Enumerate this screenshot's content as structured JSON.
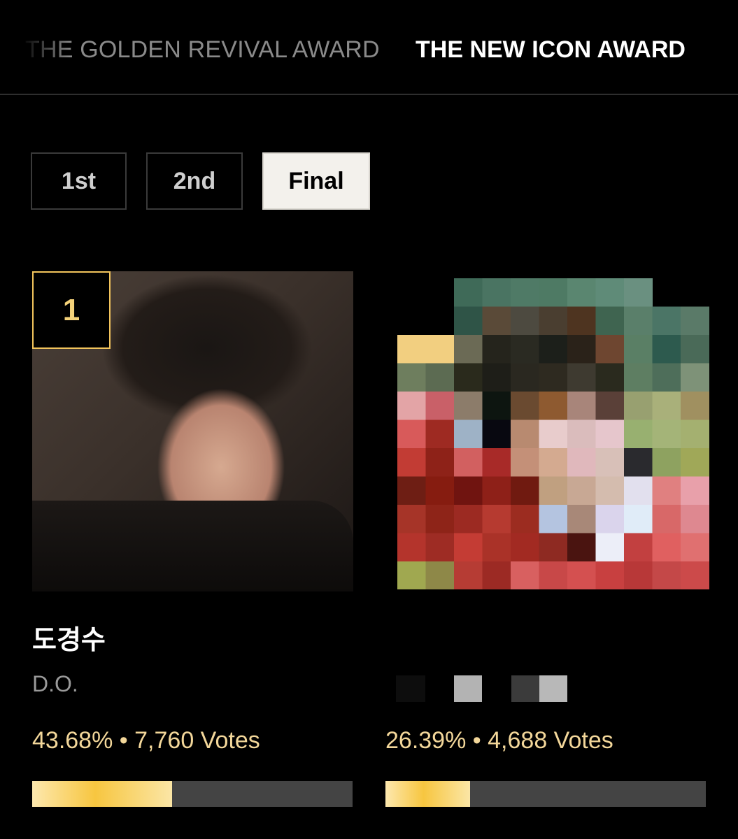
{
  "award_tabs": [
    {
      "label": "THE GOLDEN REVIVAL AWARD",
      "active": false
    },
    {
      "label": "THE NEW ICON AWARD",
      "active": true
    }
  ],
  "rounds": [
    {
      "label": "1st",
      "selected": false
    },
    {
      "label": "2nd",
      "selected": false
    },
    {
      "label": "Final",
      "selected": true
    }
  ],
  "candidates": [
    {
      "rank": "1",
      "name_kr": "도경수",
      "name_en": "D.O.",
      "percent": "43.68%",
      "separator": "•",
      "votes": "7,760 Votes",
      "progress": 0.4368
    },
    {
      "percent": "26.39%",
      "separator": "•",
      "votes": "4,688 Votes",
      "progress": 0.2639,
      "image_pixelated": true
    }
  ],
  "colors": {
    "background": "#000000",
    "accent_gold": "#f2c45c",
    "stat_text": "#f3d79a",
    "bar_track": "#444444"
  }
}
